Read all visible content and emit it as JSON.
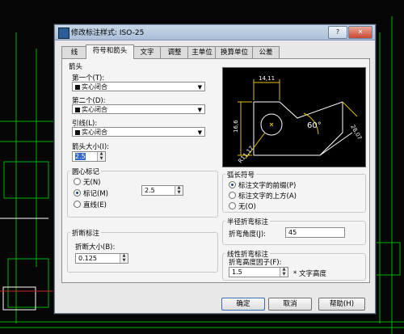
{
  "dialog": {
    "title": "修改标注样式: ISO-25",
    "close_glyph": "✕",
    "help_glyph": "?"
  },
  "tabs": [
    "线",
    "符号和箭头",
    "文字",
    "调整",
    "主单位",
    "换算单位",
    "公差"
  ],
  "arrows": {
    "section_label": "箭头",
    "first_label": "第一个(T):",
    "first_value": "实心闭合",
    "second_label": "第二个(D):",
    "second_value": "实心闭合",
    "leader_label": "引线(L):",
    "leader_value": "实心闭合",
    "size_label": "箭头大小(I):",
    "size_value": "2.5"
  },
  "center_marks": {
    "section_label": "圆心标记",
    "options": [
      "无(N)",
      "标记(M)",
      "直线(E)"
    ],
    "selected": 1,
    "size_value": "2.5"
  },
  "break": {
    "section_label": "折断标注",
    "size_label": "折断大小(B):",
    "size_value": "0.125"
  },
  "arc_symbol": {
    "section_label": "弧长符号",
    "options": [
      "标注文字的前缀(P)",
      "标注文字的上方(A)",
      "无(O)"
    ],
    "selected": 0
  },
  "radius_jog": {
    "section_label": "半径折弯标注",
    "angle_label": "折弯角度(J):",
    "angle_value": "45"
  },
  "linear_jog": {
    "section_label": "线性折弯标注",
    "factor_label": "折弯高度因子(F):",
    "factor_value": "1.5",
    "suffix": "* 文字高度"
  },
  "preview": {
    "dim_top": "14,11",
    "dim_left": "16,6",
    "dim_right": "28,07",
    "angle": "60°",
    "radius": "R11,17"
  },
  "buttons": {
    "ok": "确定",
    "cancel": "取消",
    "help": "帮助(H)"
  },
  "colors": {
    "cad_bg": "#000000",
    "cad_green": "#00c800",
    "preview_lines": "#ffffff",
    "preview_dims": "#e0c000"
  }
}
